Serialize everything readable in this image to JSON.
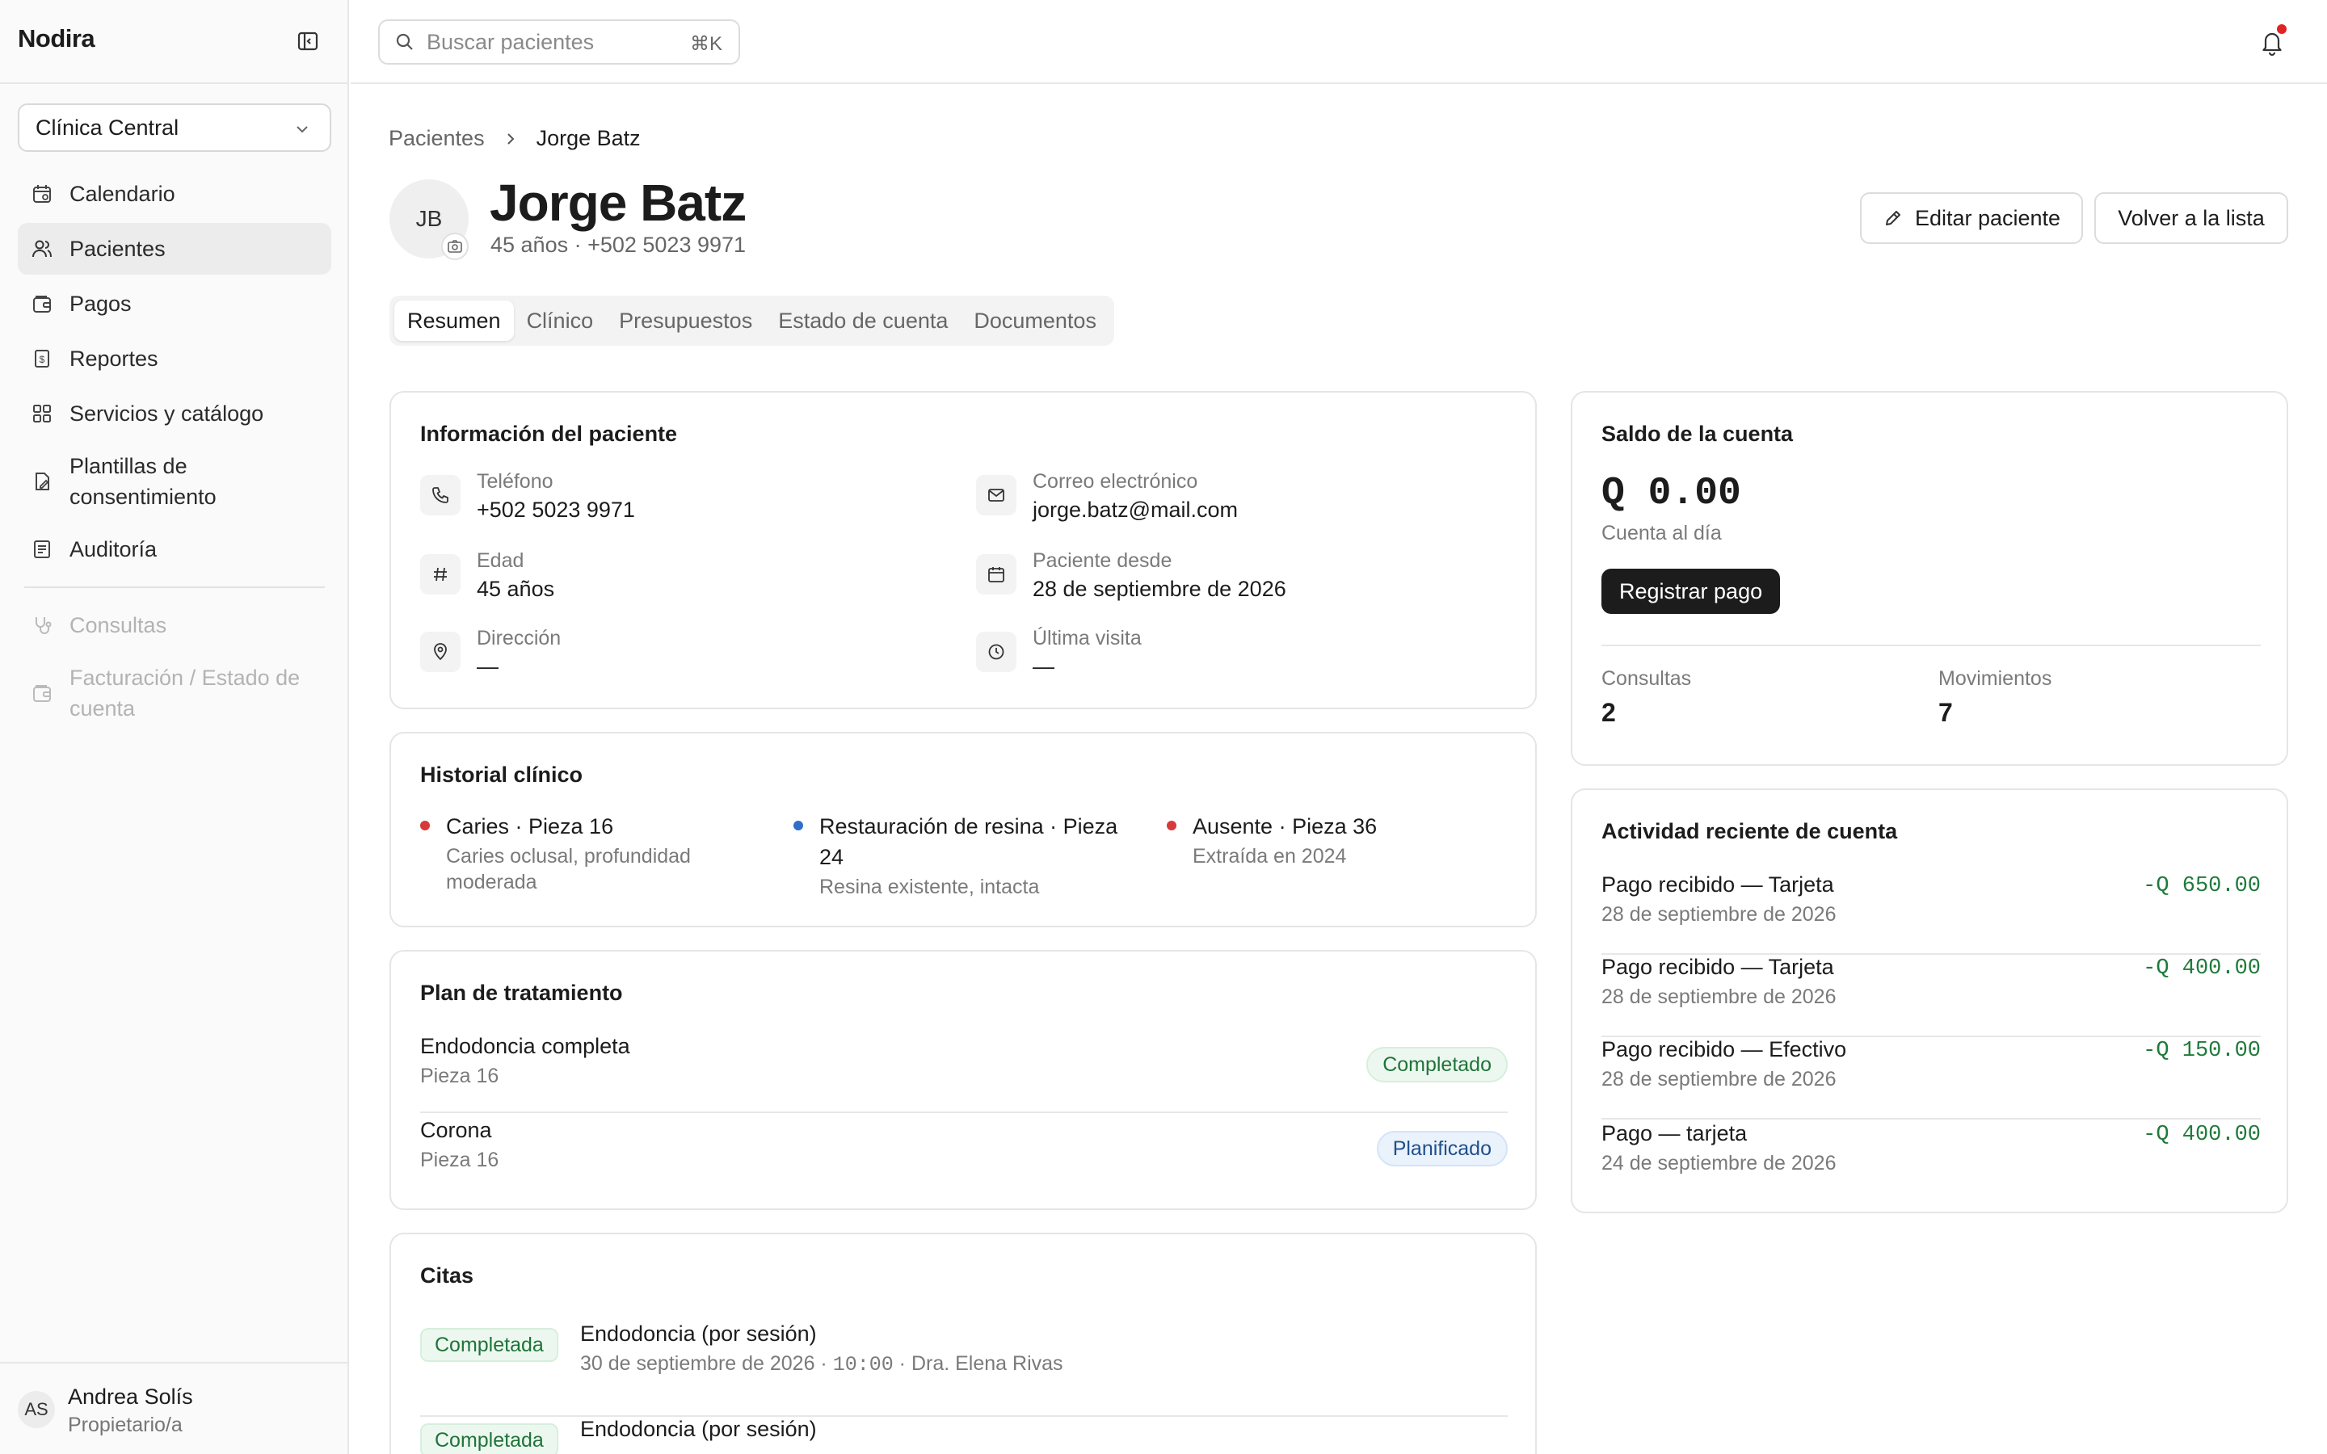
{
  "app": {
    "brand": "Nodira"
  },
  "sidebar": {
    "clinic": "Clínica Central",
    "items": [
      {
        "label": "Calendario",
        "icon": "calendar-icon"
      },
      {
        "label": "Pacientes",
        "icon": "users-icon",
        "active": true
      },
      {
        "label": "Pagos",
        "icon": "wallet-icon"
      },
      {
        "label": "Reportes",
        "icon": "receipt-icon"
      },
      {
        "label": "Servicios y catálogo",
        "icon": "grid-icon"
      },
      {
        "label": "Plantillas de consentimiento",
        "icon": "file-pen-icon"
      },
      {
        "label": "Auditoría",
        "icon": "audit-icon"
      }
    ],
    "disabled_items": [
      {
        "label": "Consultas",
        "icon": "stethoscope-icon"
      },
      {
        "label": "Facturación / Estado de cuenta",
        "icon": "wallet-icon"
      }
    ],
    "user": {
      "initials": "AS",
      "name": "Andrea Solís",
      "role": "Propietario/a"
    }
  },
  "topbar": {
    "search_placeholder": "Buscar pacientes",
    "search_shortcut": "⌘K"
  },
  "breadcrumb": {
    "parent": "Pacientes",
    "current": "Jorge Batz"
  },
  "patient": {
    "initials": "JB",
    "name": "Jorge Batz",
    "subtitle": "45 años · +502 5023 9971"
  },
  "actions": {
    "edit": "Editar paciente",
    "back": "Volver a la lista"
  },
  "tabs": [
    "Resumen",
    "Clínico",
    "Presupuestos",
    "Estado de cuenta",
    "Documentos"
  ],
  "info": {
    "title": "Información del paciente",
    "fields": [
      {
        "label": "Teléfono",
        "value": "+502 5023 9971",
        "icon": "phone-icon"
      },
      {
        "label": "Correo electrónico",
        "value": "jorge.batz@mail.com",
        "icon": "mail-icon"
      },
      {
        "label": "Edad",
        "value": "45 años",
        "icon": "hash-icon"
      },
      {
        "label": "Paciente desde",
        "value": "28 de septiembre de 2026",
        "icon": "calendar-icon"
      },
      {
        "label": "Dirección",
        "value": "—",
        "icon": "map-pin-icon"
      },
      {
        "label": "Última visita",
        "value": "—",
        "icon": "clock-icon"
      }
    ]
  },
  "history": {
    "title": "Historial clínico",
    "items": [
      {
        "title": "Caries · Pieza 16",
        "desc": "Caries oclusal, profundidad moderada",
        "color": "#d63a3a"
      },
      {
        "title": "Restauración de resina · Pieza 24",
        "desc": "Resina existente, intacta",
        "color": "#2f6fc9"
      },
      {
        "title": "Ausente · Pieza 36",
        "desc": "Extraída en 2024",
        "color": "#d63a3a"
      }
    ]
  },
  "plan": {
    "title": "Plan de tratamiento",
    "items": [
      {
        "name": "Endodoncia completa",
        "detail": "Pieza 16",
        "status": "Completado"
      },
      {
        "name": "Corona",
        "detail": "Pieza 16",
        "status": "Planificado"
      }
    ]
  },
  "appointments": {
    "title": "Citas",
    "items": [
      {
        "status": "Completada",
        "title": "Endodoncia (por sesión)",
        "date": "30 de septiembre de 2026 · ",
        "time": "10:00",
        "doctor": " · Dra. Elena Rivas"
      },
      {
        "status": "Completada",
        "title": "Endodoncia (por sesión)",
        "date": "",
        "time": "",
        "doctor": ""
      }
    ]
  },
  "balance": {
    "title": "Saldo de la cuenta",
    "amount": "Q 0.00",
    "status": "Cuenta al día",
    "pay_button": "Registrar pago",
    "stats": [
      {
        "label": "Consultas",
        "value": "2"
      },
      {
        "label": "Movimientos",
        "value": "7"
      }
    ]
  },
  "activity": {
    "title": "Actividad reciente de cuenta",
    "items": [
      {
        "title": "Pago recibido — Tarjeta",
        "date": "28 de septiembre de 2026",
        "amount": "-Q 650.00"
      },
      {
        "title": "Pago recibido — Tarjeta",
        "date": "28 de septiembre de 2026",
        "amount": "-Q 400.00"
      },
      {
        "title": "Pago recibido — Efectivo",
        "date": "28 de septiembre de 2026",
        "amount": "-Q 150.00"
      },
      {
        "title": "Pago — tarjeta",
        "date": "24 de septiembre de 2026",
        "amount": "-Q 400.00"
      }
    ]
  }
}
